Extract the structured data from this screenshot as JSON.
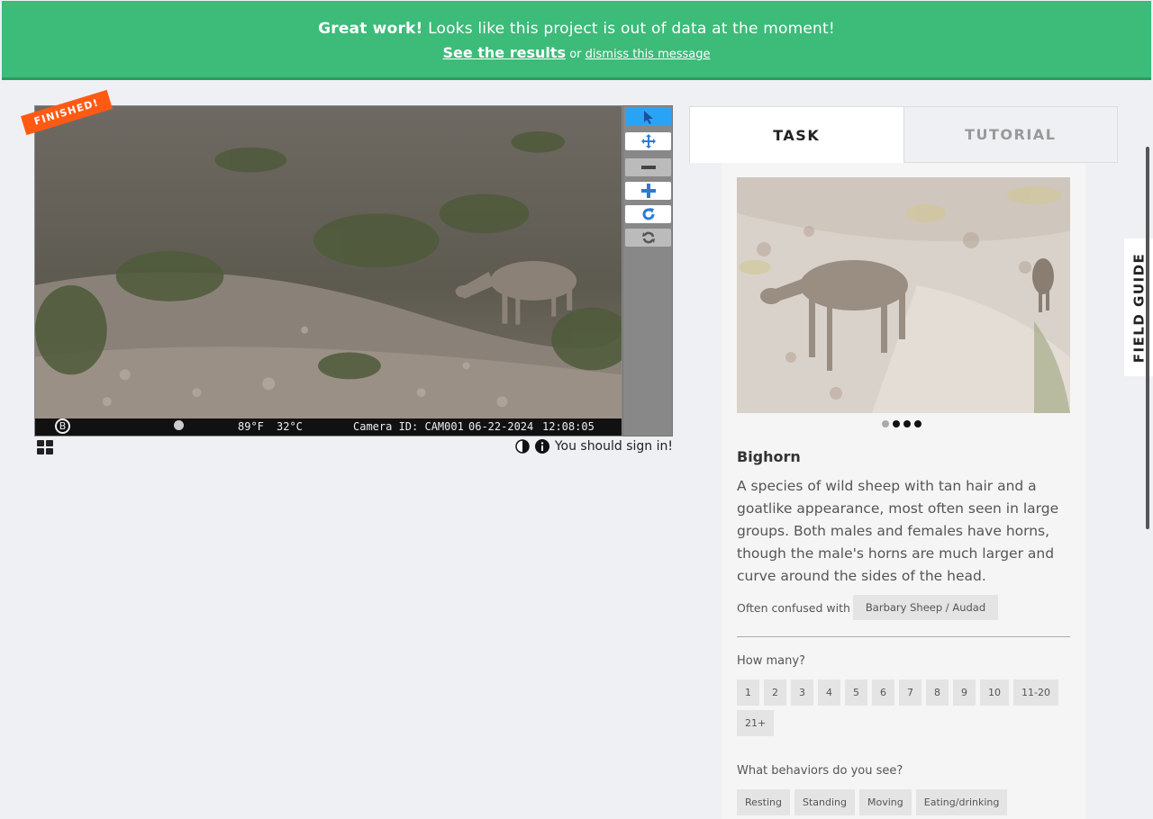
{
  "banner": {
    "bold": "Great work!",
    "message": " Looks like this project is out of data at the moment!",
    "results_link": "See the results",
    "or_text": "or",
    "dismiss_link": "dismiss this message"
  },
  "viewer": {
    "finished_badge": "FINISHED!",
    "camera_bar": {
      "logo": "B",
      "temp_f": "89°F",
      "temp_c": "32°C",
      "camera_id": "Camera ID: CAM001",
      "date": "06-22-2024",
      "time": "12:08:05"
    },
    "tools": [
      "pointer-icon",
      "move-icon",
      "zoom-out-icon",
      "zoom-in-icon",
      "rotate-icon",
      "reset-icon"
    ],
    "sign_in_text": "You should sign in!"
  },
  "tabs": {
    "task": "TASK",
    "tutorial": "TUTORIAL"
  },
  "species": {
    "name": "Bighorn",
    "description": "A species of wild sheep with tan hair and a goatlike appearance, most often seen in large groups. Both males and females have horns, though the male's horns are much larger and curve around the sides of the head.",
    "confused_label": "Often confused with",
    "confused_with": "Barbary Sheep / Audad"
  },
  "how_many": {
    "label": "How many?",
    "options": [
      "1",
      "2",
      "3",
      "4",
      "5",
      "6",
      "7",
      "8",
      "9",
      "10",
      "11-20",
      "21+"
    ]
  },
  "behaviors": {
    "label": "What behaviors do you see?",
    "options": [
      "Resting",
      "Standing",
      "Moving",
      "Eating/drinking"
    ]
  },
  "field_guide": "FIELD GUIDE",
  "colors": {
    "banner": "#3cbb79",
    "badge": "#ff5a14",
    "active_tool": "#2ba3f5"
  }
}
